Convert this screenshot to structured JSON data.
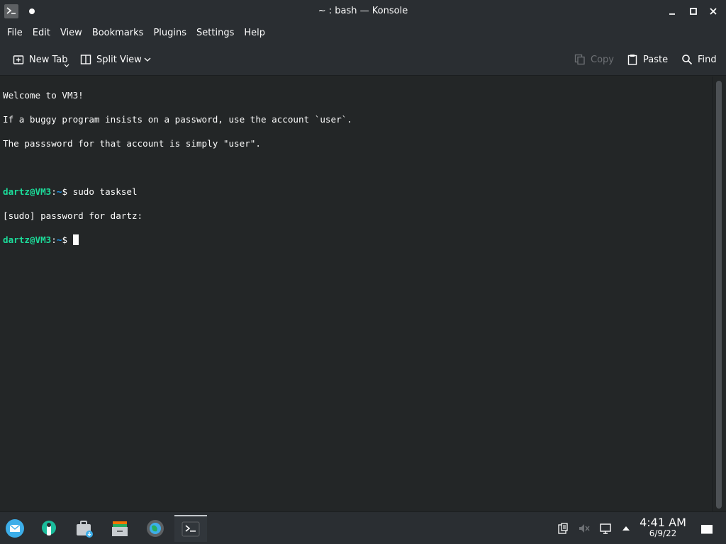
{
  "window": {
    "title": "~ : bash — Konsole"
  },
  "menubar": {
    "items": [
      "File",
      "Edit",
      "View",
      "Bookmarks",
      "Plugins",
      "Settings",
      "Help"
    ]
  },
  "toolbar": {
    "new_tab": "New Tab",
    "split_view": "Split View",
    "copy": "Copy",
    "paste": "Paste",
    "find": "Find"
  },
  "terminal": {
    "lines": [
      "Welcome to VM3!",
      "If a buggy program insists on a password, use the account `user`.",
      "The passsword for that account is simply \"user\".",
      ""
    ],
    "prompt_user": "dartz@VM3",
    "prompt_sep": ":",
    "prompt_path": "~",
    "prompt_symbol": "$ ",
    "command_1": "sudo tasksel",
    "sudo_prompt": "[sudo] password for dartz:",
    "command_2": ""
  },
  "taskbar": {
    "apps": [
      "mail-icon",
      "plasma-discover-icon",
      "software-center-icon",
      "file-manager-icon",
      "web-browser-icon",
      "konsole-icon"
    ],
    "tray": [
      "clipboard-icon",
      "volume-muted-icon",
      "network-icon",
      "expand-tray-icon"
    ],
    "clock_time": "4:41 AM",
    "clock_date": "6/9/22"
  },
  "colors": {
    "prompt_user": "#1cdc9a",
    "prompt_path": "#1d99f3",
    "background": "#232627",
    "chrome": "#2a2e32"
  }
}
